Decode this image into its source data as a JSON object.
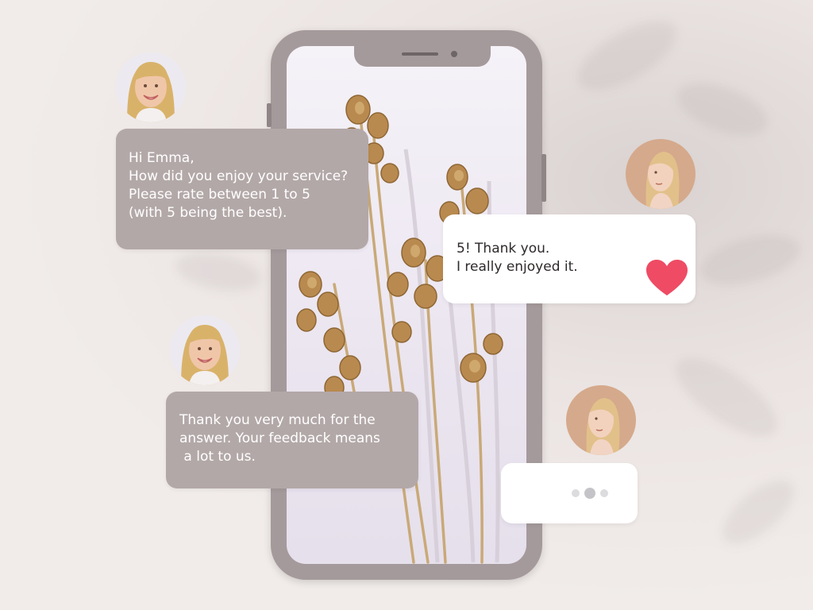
{
  "conversation": {
    "message_1": {
      "sender": "business",
      "lines": [
        "Hi Emma,",
        "How did you enjoy your service?",
        "Please rate between 1 to 5",
        "(with 5 being the best)."
      ]
    },
    "message_2": {
      "sender": "emma",
      "lines": [
        "5! Thank you.",
        "I really enjoyed it."
      ],
      "reaction_icon": "heart-icon"
    },
    "message_3": {
      "sender": "business",
      "lines": [
        "Thank you very much for the",
        "answer. Your feedback means",
        " a lot to us."
      ]
    },
    "message_4": {
      "sender": "emma",
      "status": "typing-indicator"
    }
  },
  "colors": {
    "grey_bubble": "#b3a8a8",
    "white_bubble": "#ffffff",
    "heart": "#ef4b64",
    "phone_frame": "#a59a9b",
    "background": "#efe9e7"
  }
}
